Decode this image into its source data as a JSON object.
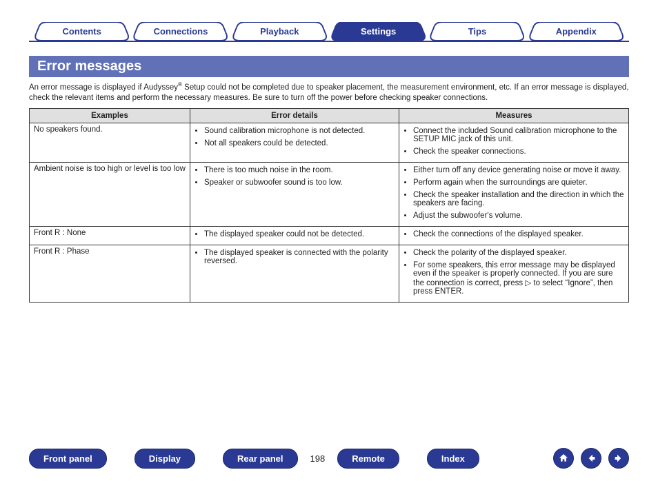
{
  "tabs": [
    {
      "label": "Contents",
      "active": false
    },
    {
      "label": "Connections",
      "active": false
    },
    {
      "label": "Playback",
      "active": false
    },
    {
      "label": "Settings",
      "active": true
    },
    {
      "label": "Tips",
      "active": false
    },
    {
      "label": "Appendix",
      "active": false
    }
  ],
  "heading": "Error messages",
  "intro_pre": "An error message is displayed if Audyssey",
  "intro_post": " Setup could not be completed due to speaker placement, the measurement environment, etc. If an error message is displayed, check the relevant items and perform the necessary measures. Be sure to turn off the power before checking speaker connections.",
  "table": {
    "headers": [
      "Examples",
      "Error details",
      "Measures"
    ],
    "rows": [
      {
        "example": "No speakers found.",
        "details": [
          "Sound calibration microphone is not detected.",
          "Not all speakers could be detected."
        ],
        "measures": [
          "Connect the included Sound calibration microphone to the SETUP MIC jack of this unit.",
          "Check the speaker connections."
        ]
      },
      {
        "example": "Ambient noise is too high or level is too low",
        "details": [
          "There is too much noise in the room.",
          "Speaker or subwoofer sound is too low."
        ],
        "measures": [
          "Either turn off any device generating noise or move it away.",
          "Perform again when the surroundings are quieter.",
          "Check the speaker installation and the direction in which the speakers are facing.",
          "Adjust the subwoofer's volume."
        ]
      },
      {
        "example": "Front R : None",
        "details": [
          "The displayed speaker could not be detected."
        ],
        "measures": [
          "Check the connections of the displayed speaker."
        ]
      },
      {
        "example": "Front R : Phase",
        "details": [
          "The displayed speaker is connected with the polarity reversed."
        ],
        "measures": [
          "Check the polarity of the displayed speaker.",
          "For some speakers, this error message may be displayed even if the speaker is properly connected. If you are sure the connection is correct, press ▷ to select “Ignore”, then press ENTER."
        ]
      }
    ]
  },
  "footer": {
    "front_panel": "Front panel",
    "display": "Display",
    "rear_panel": "Rear panel",
    "page": "198",
    "remote": "Remote",
    "index": "Index"
  }
}
